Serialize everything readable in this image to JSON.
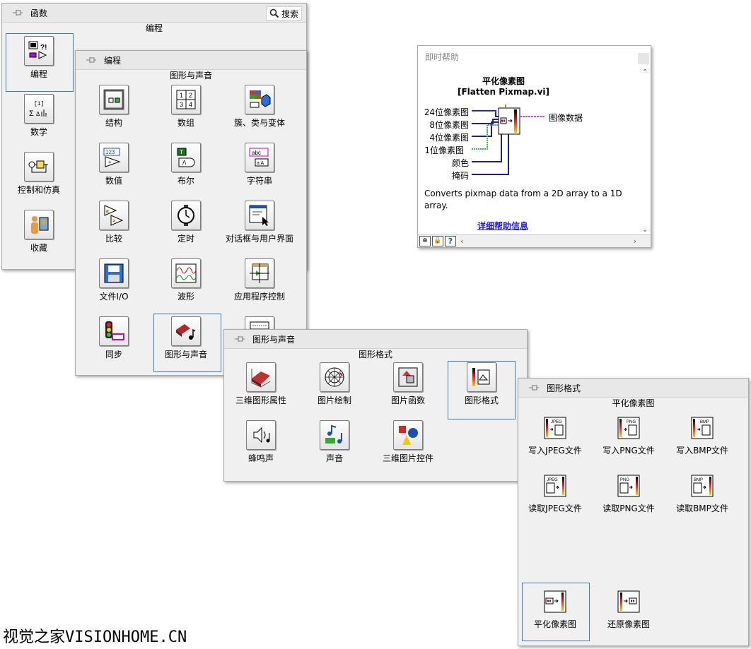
{
  "functions_palette": {
    "title": "函数",
    "search_label": "搜索",
    "subtitle": "编程",
    "items": [
      {
        "label": "编程",
        "icon": "programming-icon"
      },
      {
        "label": "数学",
        "icon": "math-icon"
      },
      {
        "label": "控制和仿真",
        "icon": "control-sim-icon"
      },
      {
        "label": "收藏",
        "icon": "favorites-icon"
      }
    ]
  },
  "programming_palette": {
    "title": "编程",
    "subtitle": "图形与声音",
    "items": [
      {
        "label": "结构",
        "icon": "structures-icon"
      },
      {
        "label": "数组",
        "icon": "array-icon"
      },
      {
        "label": "簇、类与变体",
        "icon": "cluster-icon"
      },
      {
        "label": "数值",
        "icon": "numeric-icon"
      },
      {
        "label": "布尔",
        "icon": "boolean-icon"
      },
      {
        "label": "字符串",
        "icon": "string-icon"
      },
      {
        "label": "比较",
        "icon": "comparison-icon"
      },
      {
        "label": "定时",
        "icon": "timing-icon"
      },
      {
        "label": "对话框与用户界面",
        "icon": "dialog-ui-icon"
      },
      {
        "label": "文件I/O",
        "icon": "file-io-icon"
      },
      {
        "label": "波形",
        "icon": "waveform-icon"
      },
      {
        "label": "应用程序控制",
        "icon": "app-control-icon"
      },
      {
        "label": "同步",
        "icon": "sync-icon"
      },
      {
        "label": "图形与声音",
        "icon": "graphics-sound-icon"
      }
    ]
  },
  "graphics_palette": {
    "title": "图形与声音",
    "subtitle": "图形格式",
    "items": [
      {
        "label": "三维图形属性",
        "icon": "3d-graph-props-icon"
      },
      {
        "label": "图片绘制",
        "icon": "picture-plot-icon"
      },
      {
        "label": "图片函数",
        "icon": "picture-functions-icon"
      },
      {
        "label": "图形格式",
        "icon": "graphics-formats-icon"
      },
      {
        "label": "蜂鸣声",
        "icon": "beep-icon"
      },
      {
        "label": "声音",
        "icon": "sound-icon"
      },
      {
        "label": "三维图片控件",
        "icon": "3d-picture-control-icon"
      }
    ]
  },
  "formats_palette": {
    "title": "图形格式",
    "subtitle": "平化像素图",
    "items": [
      {
        "label": "写入JPEG文件",
        "tag": "JPEG"
      },
      {
        "label": "写入PNG文件",
        "tag": "PNG"
      },
      {
        "label": "写入BMP文件",
        "tag": "BMP"
      },
      {
        "label": "读取JPEG文件",
        "tag": "JPEG"
      },
      {
        "label": "读取PNG文件",
        "tag": "PNG"
      },
      {
        "label": "读取BMP文件",
        "tag": "BMP"
      },
      {
        "label": "平化像素图",
        "tag": ""
      },
      {
        "label": "还原像素图",
        "tag": ""
      }
    ]
  },
  "context_help": {
    "title": "即时帮助",
    "vi_name": "平化像素图",
    "vi_file": "[Flatten Pixmap.vi]",
    "inputs": [
      "24位像素图",
      "8位像素图",
      "4位像素图",
      "1位像素图",
      "颜色",
      "掩码"
    ],
    "output": "图像数据",
    "description": "Converts pixmap data from a 2D array to a 1D array.",
    "detailed_help_link": "详细帮助信息"
  },
  "watermark": "视觉之家VISIONHOME.CN"
}
